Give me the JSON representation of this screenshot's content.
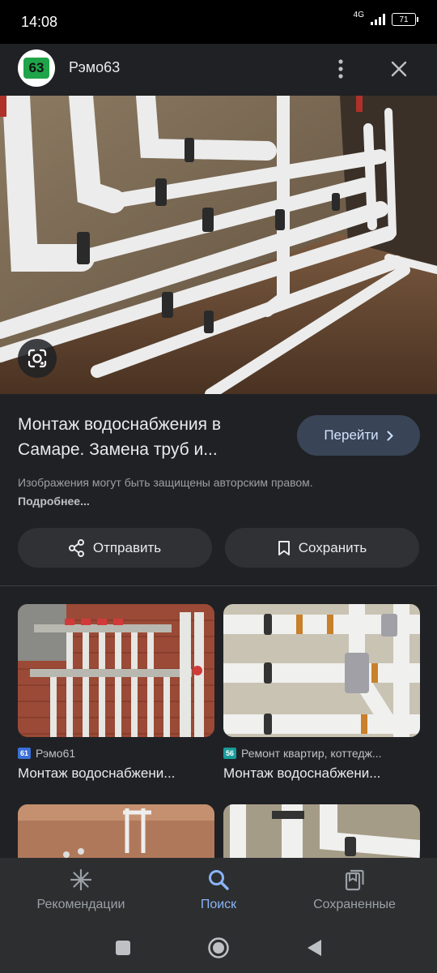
{
  "status_bar": {
    "time": "14:08",
    "network": "4G",
    "battery": "71"
  },
  "header": {
    "site_logo_text": "63",
    "site_name": "Рэмо63",
    "more_icon": "more-vert-icon",
    "close_icon": "close-icon"
  },
  "hero": {
    "lens_icon": "google-lens-icon"
  },
  "result": {
    "title": "Монтаж водоснабжения в Самаре. Замена труб и...",
    "goto_label": "Перейти",
    "copyright_text": "Изображения могут быть защищены авторским правом.",
    "more_link": "Подробнее..."
  },
  "actions": {
    "share_label": "Отправить",
    "save_label": "Сохранить"
  },
  "related": [
    {
      "favicon_text": "61",
      "favicon_color": "#3b6fd8",
      "source": "Рэмо61",
      "title": "Монтаж водоснабжени..."
    },
    {
      "favicon_text": "56",
      "favicon_color": "#1a9b9b",
      "source": "Ремонт квартир, коттедж...",
      "title": "Монтаж водоснабжени..."
    }
  ],
  "bottom_nav": {
    "items": [
      {
        "label": "Рекомендации",
        "icon": "asterisk-icon",
        "active": false
      },
      {
        "label": "Поиск",
        "icon": "search-icon",
        "active": true
      },
      {
        "label": "Сохраненные",
        "icon": "collections-icon",
        "active": false
      }
    ]
  },
  "colors": {
    "background": "#202124",
    "accent": "#8ab4f8",
    "goto_button": "#394457"
  }
}
